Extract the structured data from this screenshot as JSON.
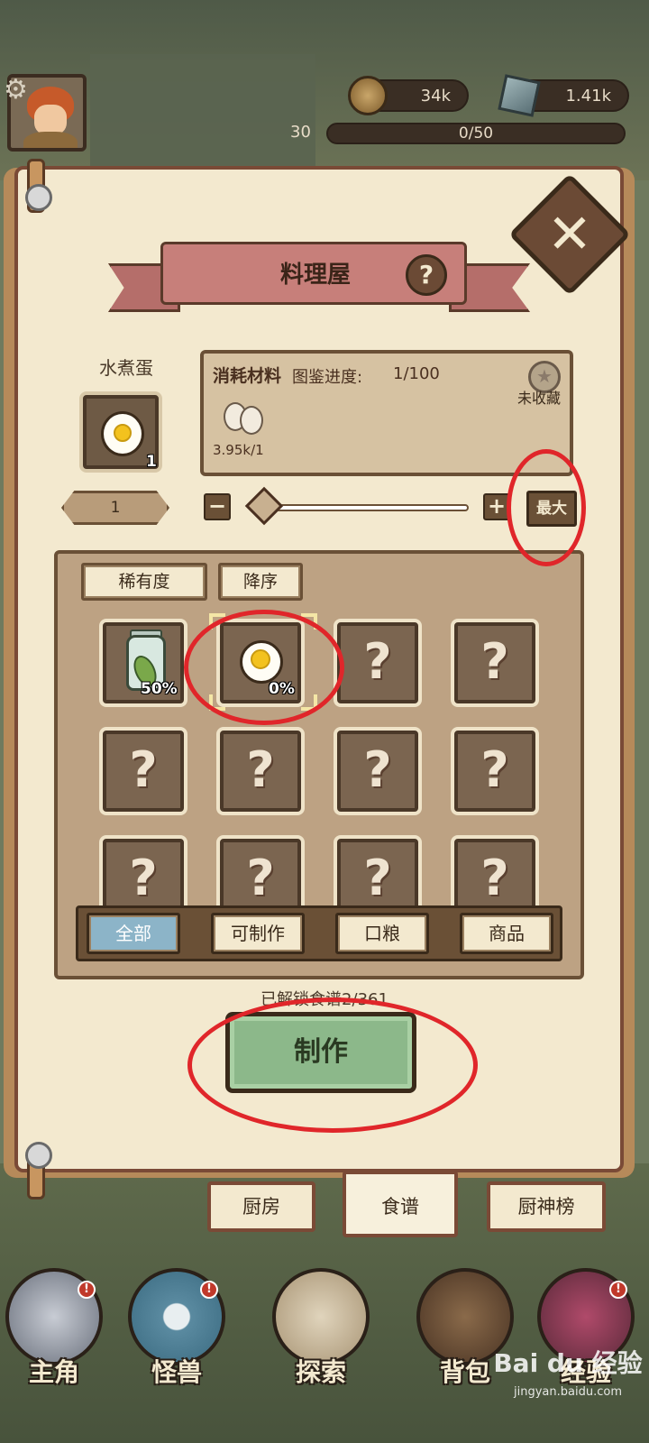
{
  "top_bar": {
    "gold": "34k",
    "gems": "1.41k",
    "level": "30",
    "xp": "0/50"
  },
  "kitchen": {
    "title": "料理屋",
    "selected_recipe": {
      "name": "水煮蛋",
      "quantity_badge": "1",
      "make_count": "1"
    },
    "materials": {
      "title": "消耗材料",
      "progress_label": "图鉴进度:",
      "progress_value": "1/100",
      "amount": "3.95k/1",
      "favorite_label": "未收藏"
    },
    "slider": {
      "minus": "−",
      "plus": "+",
      "max_label": "最大",
      "value_fraction": 0
    },
    "sort": {
      "rarity_label": "稀有度",
      "order_label": "降序"
    },
    "recipes": [
      {
        "icon": "pickle-jar-icon",
        "percent": "50%"
      },
      {
        "icon": "boiled-egg-icon",
        "percent": "0%",
        "selected": true
      },
      {
        "icon": "unknown-recipe-icon",
        "glyph": "?"
      },
      {
        "icon": "unknown-recipe-icon",
        "glyph": "?"
      },
      {
        "icon": "unknown-recipe-icon",
        "glyph": "?"
      },
      {
        "icon": "unknown-recipe-icon",
        "glyph": "?"
      },
      {
        "icon": "unknown-recipe-icon",
        "glyph": "?"
      },
      {
        "icon": "unknown-recipe-icon",
        "glyph": "?"
      },
      {
        "icon": "unknown-recipe-icon",
        "glyph": "?"
      },
      {
        "icon": "unknown-recipe-icon",
        "glyph": "?"
      },
      {
        "icon": "unknown-recipe-icon",
        "glyph": "?"
      },
      {
        "icon": "unknown-recipe-icon",
        "glyph": "?"
      }
    ],
    "filters": [
      "全部",
      "可制作",
      "口粮",
      "商品"
    ],
    "active_filter": "全部",
    "unlocked_text": "已解锁食谱2/361",
    "make_button": "制作"
  },
  "tabs": [
    "厨房",
    "食谱",
    "厨神榜"
  ],
  "active_tab": "食谱",
  "bottom_nav": [
    {
      "label": "主角",
      "icon": "helmet-icon",
      "badge": "!"
    },
    {
      "label": "怪兽",
      "icon": "monster-icon",
      "badge": "!"
    },
    {
      "label": "探索",
      "icon": "map-icon"
    },
    {
      "label": "背包",
      "icon": "backpack-icon"
    },
    {
      "label": "经验",
      "icon": "book-icon",
      "badge": "!"
    }
  ],
  "watermark": {
    "logo": "Bai du 经验",
    "url": "jingyan.baidu.com"
  },
  "colors": {
    "parchment": "#f3e9cf",
    "frame": "#7a4a36",
    "slot": "#7b6550",
    "make_button": "#8cb88a",
    "active_filter": "#8cb4c8",
    "annotation_red": "#e0262a"
  }
}
